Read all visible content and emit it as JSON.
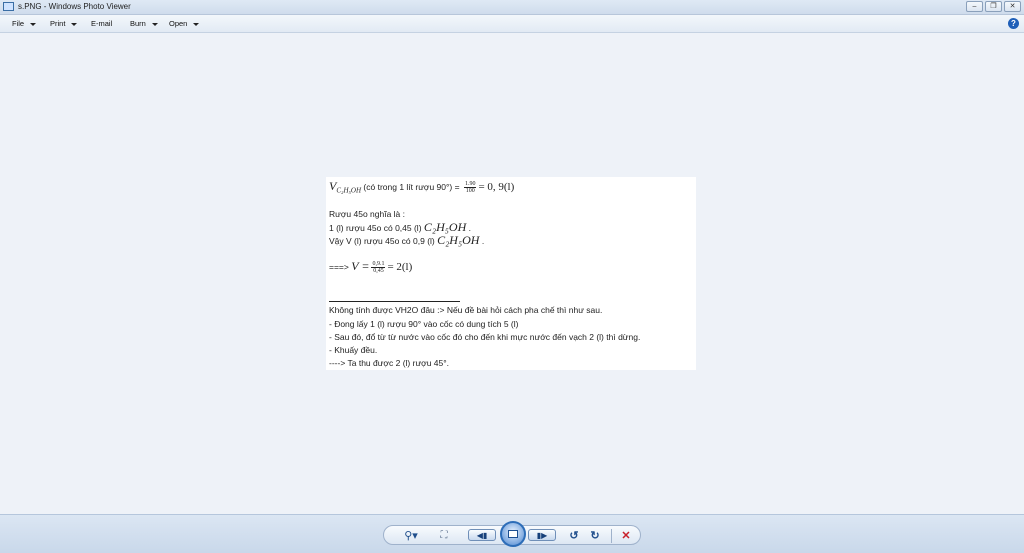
{
  "window": {
    "title": "s.PNG - Windows Photo Viewer",
    "controls": {
      "minimize": "–",
      "restore": "❐",
      "close": "✕"
    }
  },
  "menu": {
    "items": [
      {
        "label": "File",
        "has_dropdown": true
      },
      {
        "label": "Print",
        "has_dropdown": true
      },
      {
        "label": "E-mail",
        "has_dropdown": false
      },
      {
        "label": "Burn",
        "has_dropdown": true
      },
      {
        "label": "Open",
        "has_dropdown": true
      }
    ],
    "help": "?"
  },
  "document": {
    "line1": {
      "var": "V",
      "sub": "C₂H₅OH",
      "text": " (có trong 1 lít rượu 90°) = ",
      "frac_num": "1.90",
      "frac_den": "100",
      "result": "= 0, 9(l)"
    },
    "line2": "Rượu 45o nghĩa là :",
    "line3": {
      "text": "1 (l) rượu 45o có 0,45 (l) ",
      "formula": "C₂H₅OH",
      "end": " ."
    },
    "line4": {
      "text": "Vậy V (l) rượu 45o có 0,9 (l) ",
      "formula": "C₂H₅OH",
      "end": " ."
    },
    "line5": {
      "prefix": "===> ",
      "var": "V =",
      "frac_num": "0,9.1",
      "frac_den": "0,45",
      "result": "= 2(l)"
    },
    "note_lines": [
      "Không tính được VH2O đâu :> Nếu đề bài hỏi cách pha chế thì như sau.",
      "- Đong lấy 1 (l) rượu 90° vào cốc có dung tích 5 (l)",
      "- Sau đó, đổ từ từ nước vào cốc đó cho đến khi mực nước đến vạch 2 (l) thì dừng.",
      "- Khuấy đều.",
      "----> Ta thu được 2 (l) rượu 45°."
    ]
  },
  "toolbar": {
    "zoom": "⚲▾",
    "actual_size": "⛶",
    "previous": "◀▮",
    "next": "▮▶",
    "rotate_ccw": "↺",
    "rotate_cw": "↻",
    "delete": "✕"
  },
  "colors": {
    "delete": "#c8202a",
    "accent": "#2d6db8"
  }
}
